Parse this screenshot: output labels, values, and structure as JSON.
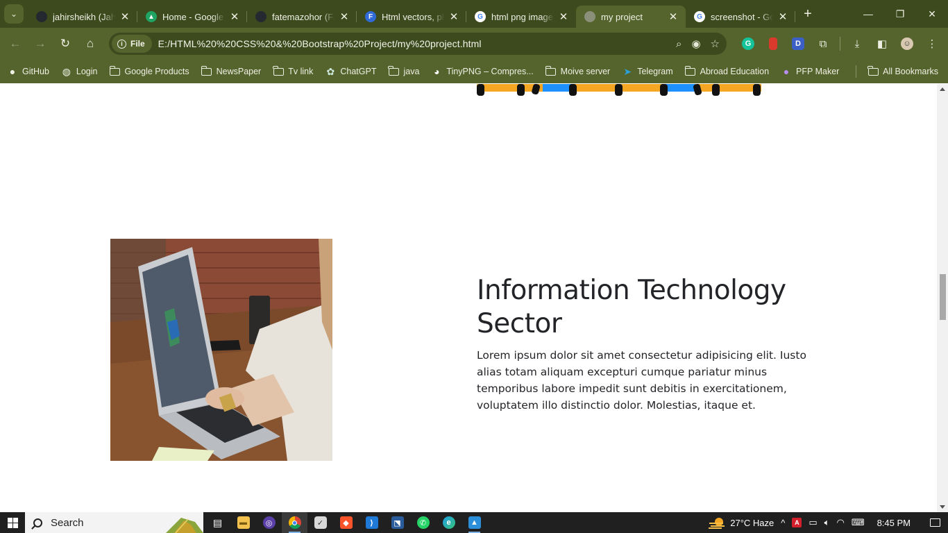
{
  "browser": {
    "tabs": [
      {
        "title": "jahirsheikh (Jahir",
        "favicon": "github-icon",
        "color": "#24292f",
        "glyph": "●"
      },
      {
        "title": "Home - Google Drive",
        "favicon": "google-drive-icon",
        "color": "#1fa463",
        "glyph": "▲"
      },
      {
        "title": "fatemazohor (Fatema",
        "favicon": "github-icon",
        "color": "#24292f",
        "glyph": "●"
      },
      {
        "title": "Html vectors, photos",
        "favicon": "freepik-icon",
        "color": "#2f6bd8",
        "glyph": "F"
      },
      {
        "title": "html png image",
        "favicon": "google-icon",
        "color": "#ffffff",
        "glyph": "G"
      },
      {
        "title": "my project",
        "favicon": "globe-icon",
        "color": "#8a8f7a",
        "glyph": "●"
      },
      {
        "title": "screenshot - Google",
        "favicon": "google-icon",
        "color": "#ffffff",
        "glyph": "G"
      }
    ],
    "active_tab_index": 5,
    "address": {
      "scheme_chip": "File",
      "url": "E:/HTML%20%20CSS%20&%20Bootstrap%20Project/my%20project.html"
    },
    "bookmarks": [
      {
        "label": "GitHub",
        "icon": "github-icon"
      },
      {
        "label": "Login",
        "icon": "globe-icon"
      },
      {
        "label": "Google Products",
        "icon": "folder-icon"
      },
      {
        "label": "NewsPaper",
        "icon": "folder-icon"
      },
      {
        "label": "Tv link",
        "icon": "folder-icon"
      },
      {
        "label": "ChatGPT",
        "icon": "chatgpt-icon"
      },
      {
        "label": "java",
        "icon": "folder-icon"
      },
      {
        "label": "TinyPNG – Compres...",
        "icon": "panda-icon"
      },
      {
        "label": "Moive server",
        "icon": "folder-icon"
      },
      {
        "label": "Telegram",
        "icon": "telegram-icon"
      },
      {
        "label": "Abroad Education",
        "icon": "folder-icon"
      },
      {
        "label": "PFP Maker",
        "icon": "pfp-icon"
      }
    ],
    "all_bookmarks": "All Bookmarks"
  },
  "page": {
    "heading": "Information Technology Sector",
    "paragraph": "Lorem ipsum dolor sit amet consectetur adipisicing elit. Iusto alias totam aliquam excepturi cumque pariatur minus temporibus labore impedit sunt debitis in exercitationem, voluptatem illo distinctio dolor. Molestias, itaque et."
  },
  "taskbar": {
    "search_label": "Search",
    "weather": "27°C  Haze",
    "time": "8:45 PM"
  }
}
